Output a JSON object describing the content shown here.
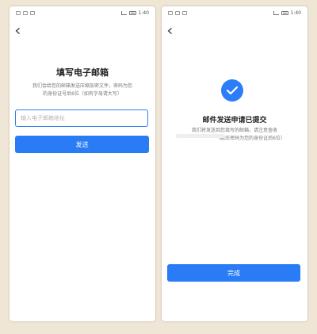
{
  "left_screen": {
    "status_time": "1:40",
    "title": "填写电子邮箱",
    "description_line1": "我们会给您的邮箱发送压缩加密文件，密码为您",
    "description_line2": "的身份证号后6位（如有字母请大写）",
    "email_placeholder": "输入电子邮箱地址",
    "send_label": "发送"
  },
  "right_screen": {
    "status_time": "1:40",
    "title": "邮件发送申请已提交",
    "description_line1": "我们将发送到您填写的邮箱，请注意查收",
    "description_line2": "（解压密码为您的身份证后6位）",
    "done_label": "完成"
  },
  "colors": {
    "accent": "#2a7cf6",
    "background": "#efe6d6"
  }
}
